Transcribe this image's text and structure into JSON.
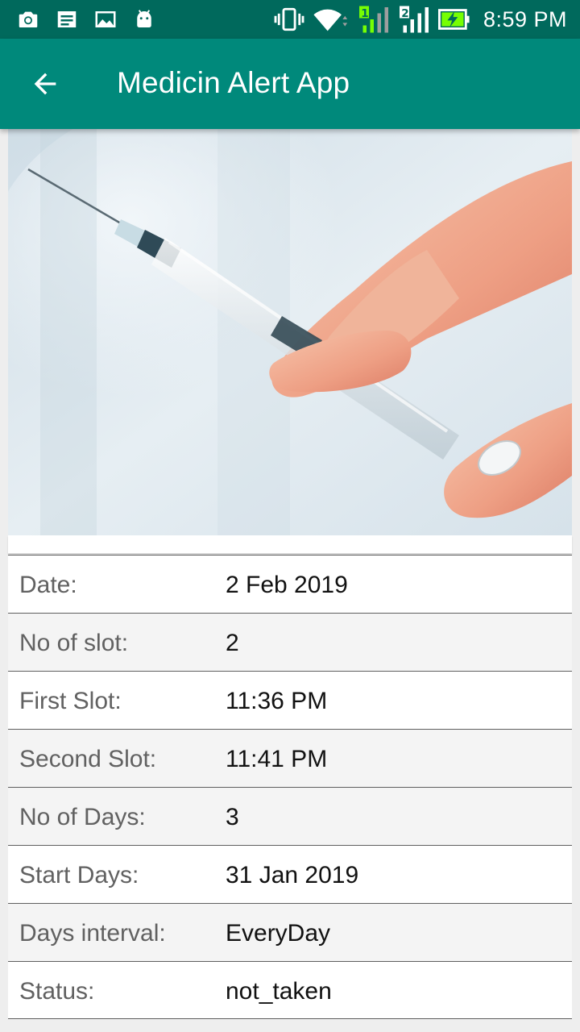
{
  "status_bar": {
    "time": "8:59 PM",
    "left_icons": [
      "camera-icon",
      "message-icon",
      "gallery-icon",
      "android-icon"
    ],
    "right_icons": [
      "vibrate-icon",
      "wifi-icon",
      "signal-sim1-icon",
      "signal-sim2-icon",
      "battery-charging-icon"
    ],
    "sim1_label": "1",
    "sim2_label": "2"
  },
  "app_bar": {
    "title": "Medicin Alert App",
    "back_icon": "arrow-back-icon"
  },
  "hero_image": {
    "subject": "hand holding syringe"
  },
  "details": [
    {
      "label": "Date:",
      "value": "2 Feb 2019"
    },
    {
      "label": "No of slot:",
      "value": "2"
    },
    {
      "label": "First Slot:",
      "value": "11:36 PM"
    },
    {
      "label": "Second Slot:",
      "value": "11:41 PM"
    },
    {
      "label": "No of Days:",
      "value": "3"
    },
    {
      "label": "Start Days:",
      "value": "31 Jan 2019"
    },
    {
      "label": "Days interval:",
      "value": "EveryDay"
    },
    {
      "label": "Status:",
      "value": "not_taken"
    }
  ],
  "colors": {
    "status_bar": "#00695c",
    "app_bar": "#00897b",
    "battery": "#76ff03"
  }
}
